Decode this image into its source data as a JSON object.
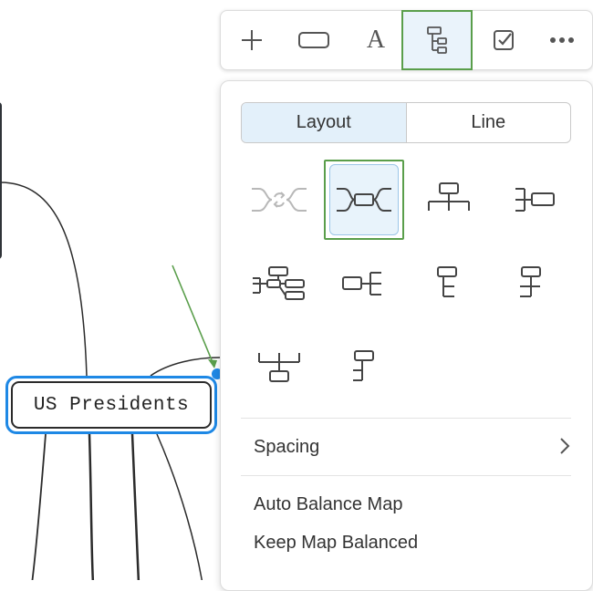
{
  "canvas": {
    "central_topic": "US Presidents"
  },
  "toolbar": {
    "buttons": [
      {
        "name": "add",
        "icon": "plus-icon"
      },
      {
        "name": "shape",
        "icon": "rounded-rectangle-icon"
      },
      {
        "name": "text",
        "icon": "text-format-icon",
        "glyph": "A"
      },
      {
        "name": "layout",
        "icon": "tree-layout-icon",
        "active": true
      },
      {
        "name": "task",
        "icon": "checkbox-icon"
      },
      {
        "name": "more",
        "icon": "more-horizontal-icon"
      }
    ]
  },
  "panel": {
    "tabs": {
      "layout": "Layout",
      "line": "Line"
    },
    "active_tab": "Layout",
    "layouts": [
      {
        "icon": "mind-map-circular-layout-icon",
        "disabled": true
      },
      {
        "icon": "mind-map-balanced-layout-icon",
        "selected": true
      },
      {
        "icon": "org-chart-down-layout-icon"
      },
      {
        "icon": "right-map-layout-icon"
      },
      {
        "icon": "mixed-org-chart-layout-icon"
      },
      {
        "icon": "left-map-layout-icon"
      },
      {
        "icon": "tree-right-layout-icon"
      },
      {
        "icon": "tree-left-layout-icon"
      },
      {
        "icon": "org-chart-up-layout-icon"
      },
      {
        "icon": "tree-list-layout-icon"
      }
    ],
    "spacing_label": "Spacing",
    "auto_balance_label": "Auto Balance Map",
    "keep_balanced_label": "Keep Map Balanced"
  },
  "colors": {
    "accent_blue": "#1e88e5",
    "selection_green": "#5a9e4b",
    "active_bg": "#e3f0fa",
    "icon_gray": "#555555"
  }
}
